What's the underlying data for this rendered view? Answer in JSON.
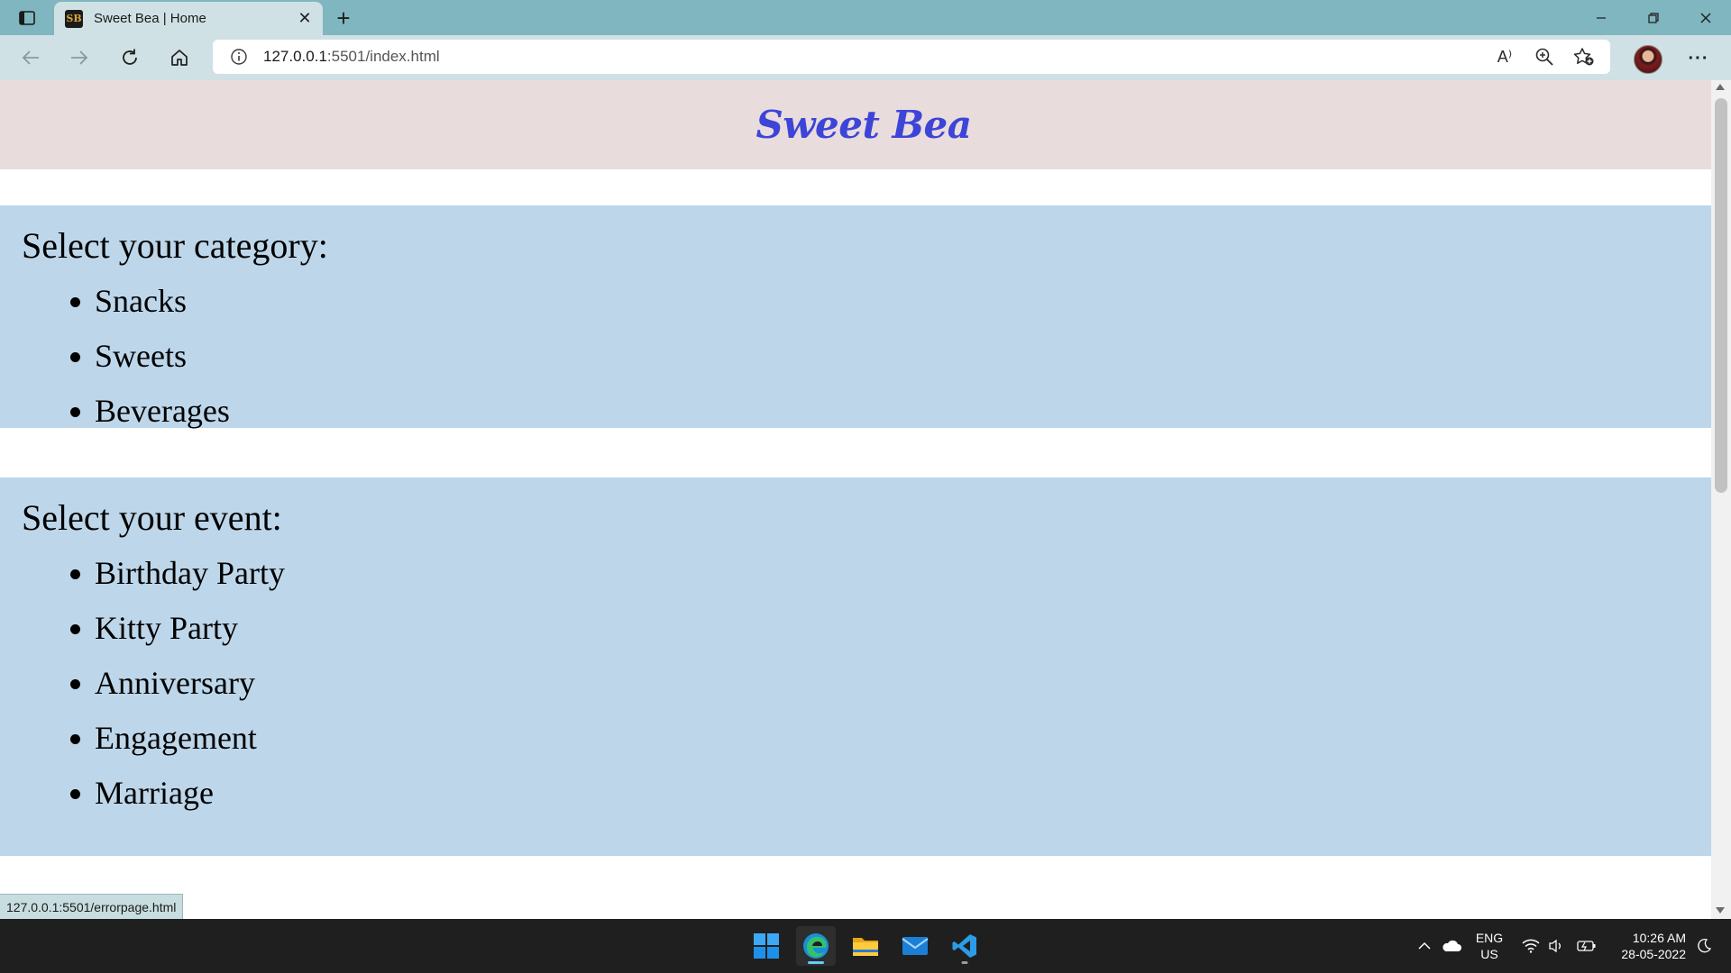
{
  "browser": {
    "tab_title": "Sweet Bea | Home",
    "favicon_text": "SB",
    "url_host": "127.0.0.1",
    "url_path": ":5501/index.html",
    "status_link": "127.0.0.1:5501/errorpage.html",
    "icons": {
      "read_aloud": "A⁾"
    }
  },
  "page": {
    "title": "Sweet Bea",
    "category_section": {
      "heading": "Select your category:",
      "items": [
        "Snacks",
        "Sweets",
        "Beverages"
      ]
    },
    "event_section": {
      "heading": "Select your event:",
      "items": [
        "Birthday Party",
        "Kitty Party",
        "Anniversary",
        "Engagement",
        "Marriage"
      ]
    }
  },
  "taskbar": {
    "lang_line1": "ENG",
    "lang_line2": "US",
    "time": "10:26 AM",
    "date": "28-05-2022"
  },
  "colors": {
    "tabbar": "#7fb6bf",
    "toolbar": "#cfe1e4",
    "header_bg": "#e8dcdd",
    "title_color": "#3d44d8",
    "section_bg": "#bdd6ea",
    "taskbar": "#1f1f1f"
  }
}
